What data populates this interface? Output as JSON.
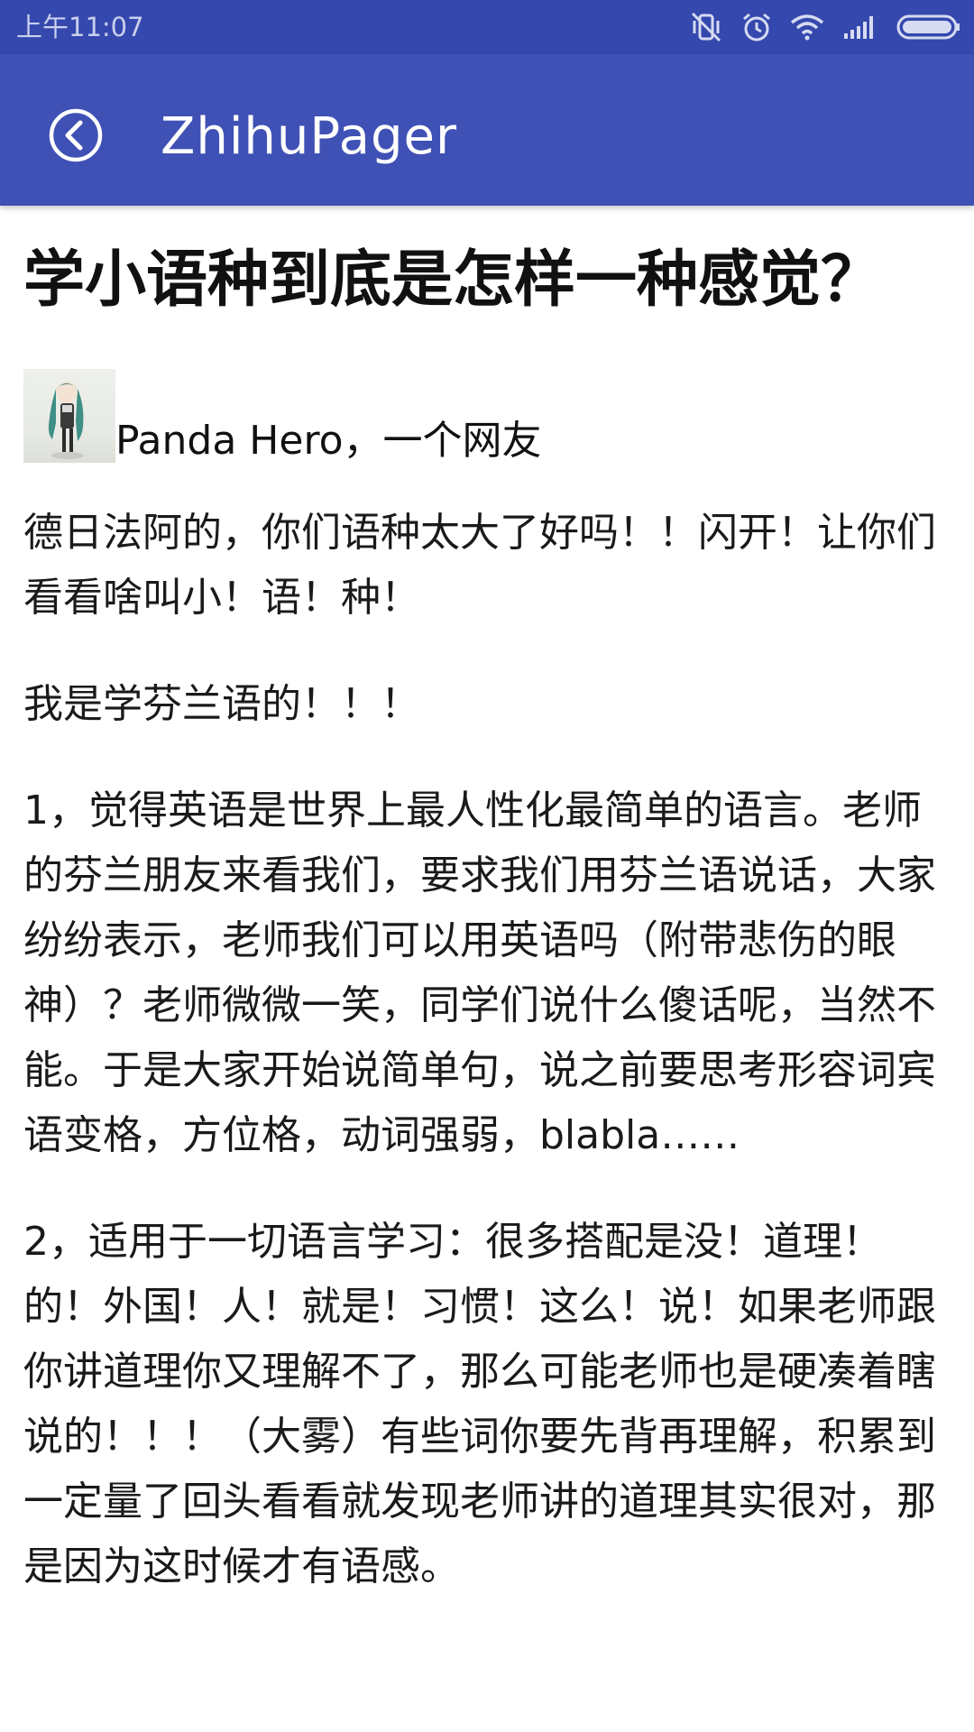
{
  "status_bar": {
    "time": "上午11:07",
    "icons": [
      "vibrate-off-icon",
      "alarm-icon",
      "wifi-icon",
      "signal-icon",
      "battery-icon"
    ]
  },
  "app_bar": {
    "title": "ZhihuPager",
    "back_icon": "back-arrow-circle-icon",
    "color": "#3f51b5",
    "status_color": "#3548ad"
  },
  "article": {
    "title": "学小语种到底是怎样一种感觉？",
    "author": {
      "name": "Panda Hero",
      "line": "Panda Hero，一个网友"
    },
    "paragraphs": [
      "德日法阿的，你们语种太大了好吗！！闪开！让你们看看啥叫小！语！种！",
      "我是学芬兰语的！！！",
      "1，觉得英语是世界上最人性化最简单的语言。老师的芬兰朋友来看我们，要求我们用芬兰语说话，大家纷纷表示，老师我们可以用英语吗（附带悲伤的眼神）？老师微微一笑，同学们说什么傻话呢，当然不能。于是大家开始说简单句，说之前要思考形容词宾语变格，方位格，动词强弱，blabla……",
      "2，适用于一切语言学习：很多搭配是没！道理！的！外国！人！就是！习惯！这么！说！如果老师跟你讲道理你又理解不了，那么可能老师也是硬凑着瞎说的！！！（大雾）有些词你要先背再理解，积累到一定量了回头看看就发现老师讲的道理其实很对，那是因为这时候才有语感。"
    ]
  }
}
